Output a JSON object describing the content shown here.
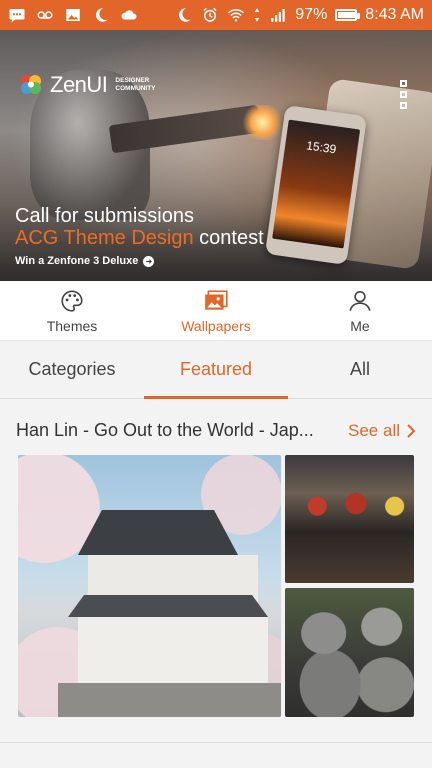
{
  "status_bar": {
    "battery_percent": "97%",
    "time": "8:43 AM",
    "battery_level": 0.97,
    "left_icons": [
      "message-icon",
      "voicemail-icon",
      "image-icon",
      "moon-icon",
      "cloud-icon"
    ],
    "right_icons": [
      "moon-icon",
      "alarm-icon",
      "wifi-icon",
      "data-arrows-icon",
      "signal-icon",
      "battery-icon"
    ]
  },
  "banner": {
    "logo_name": "ZenUI",
    "logo_sub_line1": "DESIGNER",
    "logo_sub_line2": "COMMUNITY",
    "headline_line1": "Call for submissions",
    "headline_accent": "ACG Theme Design",
    "headline_rest": " contest",
    "cta": "Win a Zenfone 3 Deluxe",
    "phone_time": "15:39",
    "slide_count": 6,
    "active_slide": 2
  },
  "main_nav": {
    "items": [
      {
        "label": "Themes",
        "icon": "palette-icon"
      },
      {
        "label": "Wallpapers",
        "icon": "wallpaper-icon"
      },
      {
        "label": "Me",
        "icon": "person-icon"
      }
    ],
    "active": "Wallpapers"
  },
  "sub_tabs": {
    "items": [
      "Categories",
      "Featured",
      "All"
    ],
    "active": "Featured"
  },
  "section": {
    "title": "Han Lin - Go Out to the World - Jap...",
    "see_all": "See all"
  },
  "colors": {
    "accent": "#e2662a",
    "status_bar": "#e2662a",
    "background": "#f3f3f3"
  }
}
